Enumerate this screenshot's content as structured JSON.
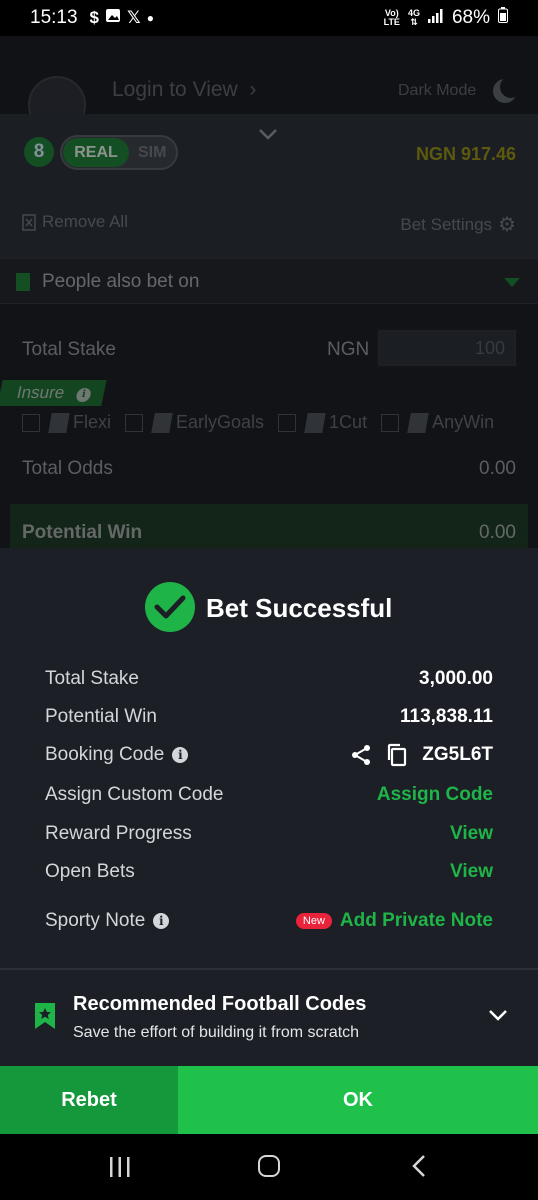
{
  "status_bar": {
    "time": "15:13",
    "notif_icons": [
      "dollar-icon",
      "image-icon",
      "x-icon",
      "dot-icon"
    ],
    "network_top": "Vo)",
    "network_bottom": "LTE",
    "network_gen": "4G",
    "battery": "68%"
  },
  "background_app": {
    "login_text": "Login to View",
    "dark_mode_label": "Dark Mode",
    "selection_count": "8",
    "toggle_real": "REAL",
    "toggle_sim": "SIM",
    "balance": "NGN 917.46",
    "remove_all": "Remove All",
    "bet_settings": "Bet Settings",
    "people_also_bet_on": "People also bet on",
    "total_stake_label": "Total Stake",
    "currency": "NGN",
    "stake_placeholder": "100",
    "insure_label": "Insure",
    "insure_options": [
      "Flexi",
      "EarlyGoals",
      "1Cut",
      "AnyWin"
    ],
    "total_odds_label": "Total Odds",
    "total_odds_value": "0.00",
    "potential_win_label": "Potential Win",
    "potential_win_value": "0.00"
  },
  "modal": {
    "title": "Bet Successful",
    "rows": {
      "total_stake": {
        "label": "Total Stake",
        "value": "3,000.00"
      },
      "potential_win": {
        "label": "Potential Win",
        "value": "113,838.11"
      },
      "booking_code": {
        "label": "Booking Code",
        "value": "ZG5L6T"
      },
      "custom_code": {
        "label": "Assign Custom Code",
        "value": "Assign Code"
      },
      "reward_progress": {
        "label": "Reward Progress",
        "value": "View"
      },
      "open_bets": {
        "label": "Open Bets",
        "value": "View"
      },
      "sporty_note": {
        "label": "Sporty Note",
        "badge": "New",
        "value": "Add Private Note"
      }
    },
    "recommended": {
      "title": "Recommended Football Codes",
      "subtitle": "Save the effort of building it from scratch"
    },
    "buttons": {
      "rebet": "Rebet",
      "ok": "OK"
    }
  },
  "colors": {
    "accent_green": "#1fc14b",
    "rebet_green": "#15973b",
    "modal_bg": "#1c1f25",
    "new_badge_red": "#e8233a"
  }
}
